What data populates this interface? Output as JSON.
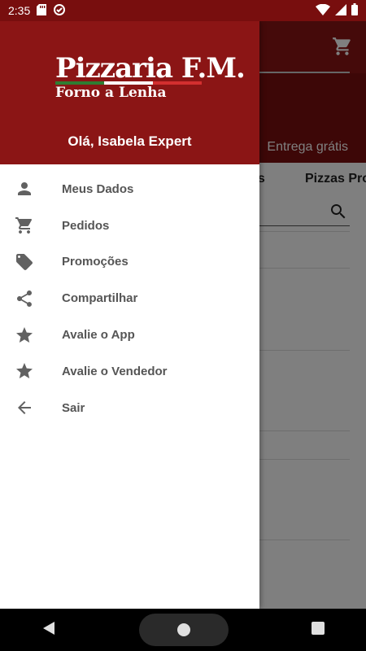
{
  "status_bar": {
    "time": "2:35"
  },
  "background": {
    "promo_text": "Entrega grátis",
    "tab_partial_1": "es",
    "tab_partial_2": "Pizzas Pro"
  },
  "drawer": {
    "logo_title": "Pizzaria F.M.",
    "logo_subtitle": "Forno a Lenha",
    "greeting": "Olá, Isabela Expert",
    "items": [
      {
        "label": "Meus Dados",
        "icon": "person-icon"
      },
      {
        "label": "Pedidos",
        "icon": "cart-icon"
      },
      {
        "label": "Promoções",
        "icon": "tag-icon"
      },
      {
        "label": "Compartilhar",
        "icon": "share-icon"
      },
      {
        "label": "Avalie o App",
        "icon": "star-icon"
      },
      {
        "label": "Avalie o Vendedor",
        "icon": "star-icon"
      },
      {
        "label": "Sair",
        "icon": "arrow-back-icon"
      }
    ]
  },
  "colors": {
    "primary": "#8b1515",
    "status_bar": "#780e0e",
    "icon_gray": "#616161",
    "label_gray": "#555555",
    "flag_green": "#2e7d32",
    "flag_white": "#ffffff",
    "flag_red": "#d32f2f"
  }
}
